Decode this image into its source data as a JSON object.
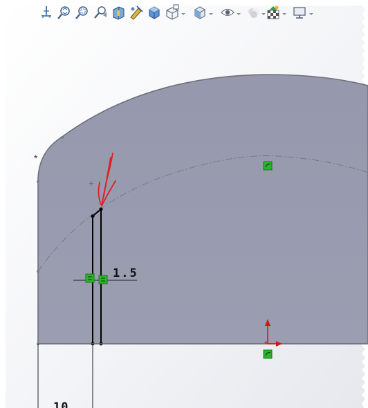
{
  "toolbar": {
    "buttons": [
      {
        "icon": "normal-to-icon"
      },
      {
        "icon": "zoom-to-fit-icon"
      },
      {
        "icon": "zoom-to-area-icon"
      },
      {
        "icon": "previous-view-icon"
      },
      {
        "icon": "section-view-icon"
      },
      {
        "icon": "dynamic-annotation-icon"
      },
      {
        "icon": "view-orientation-icon"
      },
      {
        "icon": "display-style-icon"
      },
      {
        "icon": "hide-show-items-icon"
      },
      {
        "icon": "edit-appearance-icon"
      },
      {
        "icon": "apply-scene-icon"
      },
      {
        "icon": "view-settings-icon"
      }
    ]
  },
  "sketch": {
    "dimension_width": "1.5",
    "dimension_offset": "10",
    "colors": {
      "region_fill": "#9a9cb0",
      "outline": "#6e6e78",
      "construction_line": "#7a7a84",
      "slot_lines": "#000000",
      "relation_badge": "#2bb52b",
      "annotation_arrow": "#e02020",
      "origin_arrow": "#d01818",
      "background": "#ffffff"
    }
  }
}
